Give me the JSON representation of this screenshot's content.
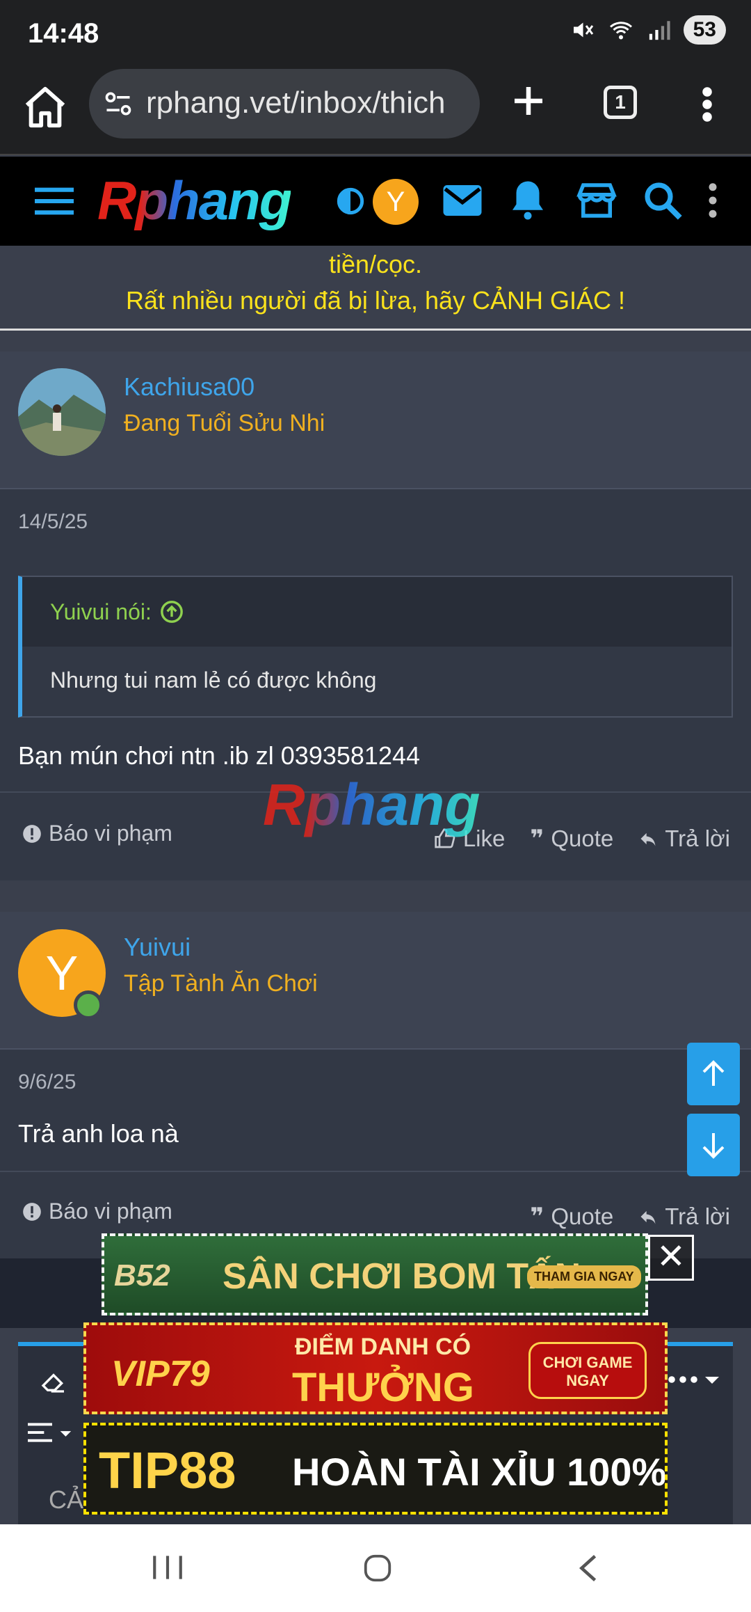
{
  "status": {
    "time": "14:48",
    "battery": "53"
  },
  "browser": {
    "url": "rphang.vet/inbox/thich",
    "tab_count": "1"
  },
  "site": {
    "logo": "Rphang",
    "user_initial": "Y"
  },
  "notice": {
    "line1": "tiền/cọc.",
    "line2": "Rất nhiều người đã bị lừa, hãy CẢNH GIÁC !"
  },
  "posts": [
    {
      "username": "Kachiusa00",
      "rank": "Đang Tuổi Sửu Nhi",
      "date": "14/5/25",
      "quote_author": "Yuivui nói:",
      "quote_text": "Nhưng tui nam lẻ có được không",
      "text": "Bạn mún chơi ntn .ib zl 0393581244",
      "report": "Báo vi phạm",
      "like": "Like",
      "quote": "Quote",
      "reply": "Trả lời"
    },
    {
      "username": "Yuivui",
      "avatar_initial": "Y",
      "rank": "Tập Tành Ăn Chơi",
      "date": "9/6/25",
      "text": "Trả anh loa nà",
      "report": "Báo vi phạm",
      "quote": "Quote",
      "reply": "Trả lời"
    }
  ],
  "watermark": "Rphang",
  "ads": {
    "b52_logo": "B52",
    "b52_text": "SÂN CHƠI BOM TẤN",
    "b52_cta": "THAM GIA NGAY",
    "vip_logo": "VIP79",
    "vip_text_1": "ĐIỂM DANH CÓ",
    "vip_text_2": "THƯỞNG",
    "vip_cta": "CHƠI GAME NGAY",
    "tip_logo": "TIP88",
    "tip_text": "HOÀN TÀI XỈU 100%"
  },
  "editor": {
    "placeholder_partial": "CẢ"
  },
  "colors": {
    "accent": "#279fe8",
    "username": "#3fa5ea",
    "rank": "#f0b020",
    "notice": "#fbe21c"
  }
}
